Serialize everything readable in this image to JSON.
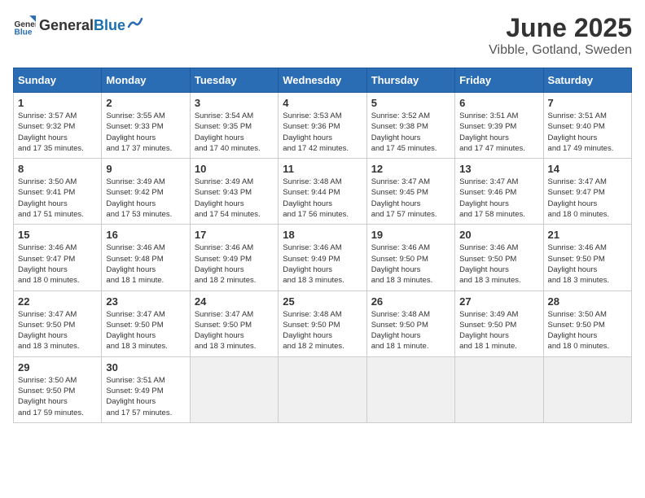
{
  "header": {
    "logo_general": "General",
    "logo_blue": "Blue",
    "month_title": "June 2025",
    "location": "Vibble, Gotland, Sweden"
  },
  "days_of_week": [
    "Sunday",
    "Monday",
    "Tuesday",
    "Wednesday",
    "Thursday",
    "Friday",
    "Saturday"
  ],
  "weeks": [
    [
      {
        "day": 1,
        "sunrise": "3:57 AM",
        "sunset": "9:32 PM",
        "daylight": "17 hours and 35 minutes."
      },
      {
        "day": 2,
        "sunrise": "3:55 AM",
        "sunset": "9:33 PM",
        "daylight": "17 hours and 37 minutes."
      },
      {
        "day": 3,
        "sunrise": "3:54 AM",
        "sunset": "9:35 PM",
        "daylight": "17 hours and 40 minutes."
      },
      {
        "day": 4,
        "sunrise": "3:53 AM",
        "sunset": "9:36 PM",
        "daylight": "17 hours and 42 minutes."
      },
      {
        "day": 5,
        "sunrise": "3:52 AM",
        "sunset": "9:38 PM",
        "daylight": "17 hours and 45 minutes."
      },
      {
        "day": 6,
        "sunrise": "3:51 AM",
        "sunset": "9:39 PM",
        "daylight": "17 hours and 47 minutes."
      },
      {
        "day": 7,
        "sunrise": "3:51 AM",
        "sunset": "9:40 PM",
        "daylight": "17 hours and 49 minutes."
      }
    ],
    [
      {
        "day": 8,
        "sunrise": "3:50 AM",
        "sunset": "9:41 PM",
        "daylight": "17 hours and 51 minutes."
      },
      {
        "day": 9,
        "sunrise": "3:49 AM",
        "sunset": "9:42 PM",
        "daylight": "17 hours and 53 minutes."
      },
      {
        "day": 10,
        "sunrise": "3:49 AM",
        "sunset": "9:43 PM",
        "daylight": "17 hours and 54 minutes."
      },
      {
        "day": 11,
        "sunrise": "3:48 AM",
        "sunset": "9:44 PM",
        "daylight": "17 hours and 56 minutes."
      },
      {
        "day": 12,
        "sunrise": "3:47 AM",
        "sunset": "9:45 PM",
        "daylight": "17 hours and 57 minutes."
      },
      {
        "day": 13,
        "sunrise": "3:47 AM",
        "sunset": "9:46 PM",
        "daylight": "17 hours and 58 minutes."
      },
      {
        "day": 14,
        "sunrise": "3:47 AM",
        "sunset": "9:47 PM",
        "daylight": "18 hours and 0 minutes."
      }
    ],
    [
      {
        "day": 15,
        "sunrise": "3:46 AM",
        "sunset": "9:47 PM",
        "daylight": "18 hours and 0 minutes."
      },
      {
        "day": 16,
        "sunrise": "3:46 AM",
        "sunset": "9:48 PM",
        "daylight": "18 hours and 1 minute."
      },
      {
        "day": 17,
        "sunrise": "3:46 AM",
        "sunset": "9:49 PM",
        "daylight": "18 hours and 2 minutes."
      },
      {
        "day": 18,
        "sunrise": "3:46 AM",
        "sunset": "9:49 PM",
        "daylight": "18 hours and 3 minutes."
      },
      {
        "day": 19,
        "sunrise": "3:46 AM",
        "sunset": "9:50 PM",
        "daylight": "18 hours and 3 minutes."
      },
      {
        "day": 20,
        "sunrise": "3:46 AM",
        "sunset": "9:50 PM",
        "daylight": "18 hours and 3 minutes."
      },
      {
        "day": 21,
        "sunrise": "3:46 AM",
        "sunset": "9:50 PM",
        "daylight": "18 hours and 3 minutes."
      }
    ],
    [
      {
        "day": 22,
        "sunrise": "3:47 AM",
        "sunset": "9:50 PM",
        "daylight": "18 hours and 3 minutes."
      },
      {
        "day": 23,
        "sunrise": "3:47 AM",
        "sunset": "9:50 PM",
        "daylight": "18 hours and 3 minutes."
      },
      {
        "day": 24,
        "sunrise": "3:47 AM",
        "sunset": "9:50 PM",
        "daylight": "18 hours and 3 minutes."
      },
      {
        "day": 25,
        "sunrise": "3:48 AM",
        "sunset": "9:50 PM",
        "daylight": "18 hours and 2 minutes."
      },
      {
        "day": 26,
        "sunrise": "3:48 AM",
        "sunset": "9:50 PM",
        "daylight": "18 hours and 1 minute."
      },
      {
        "day": 27,
        "sunrise": "3:49 AM",
        "sunset": "9:50 PM",
        "daylight": "18 hours and 1 minute."
      },
      {
        "day": 28,
        "sunrise": "3:50 AM",
        "sunset": "9:50 PM",
        "daylight": "18 hours and 0 minutes."
      }
    ],
    [
      {
        "day": 29,
        "sunrise": "3:50 AM",
        "sunset": "9:50 PM",
        "daylight": "17 hours and 59 minutes."
      },
      {
        "day": 30,
        "sunrise": "3:51 AM",
        "sunset": "9:49 PM",
        "daylight": "17 hours and 57 minutes."
      },
      null,
      null,
      null,
      null,
      null
    ]
  ]
}
